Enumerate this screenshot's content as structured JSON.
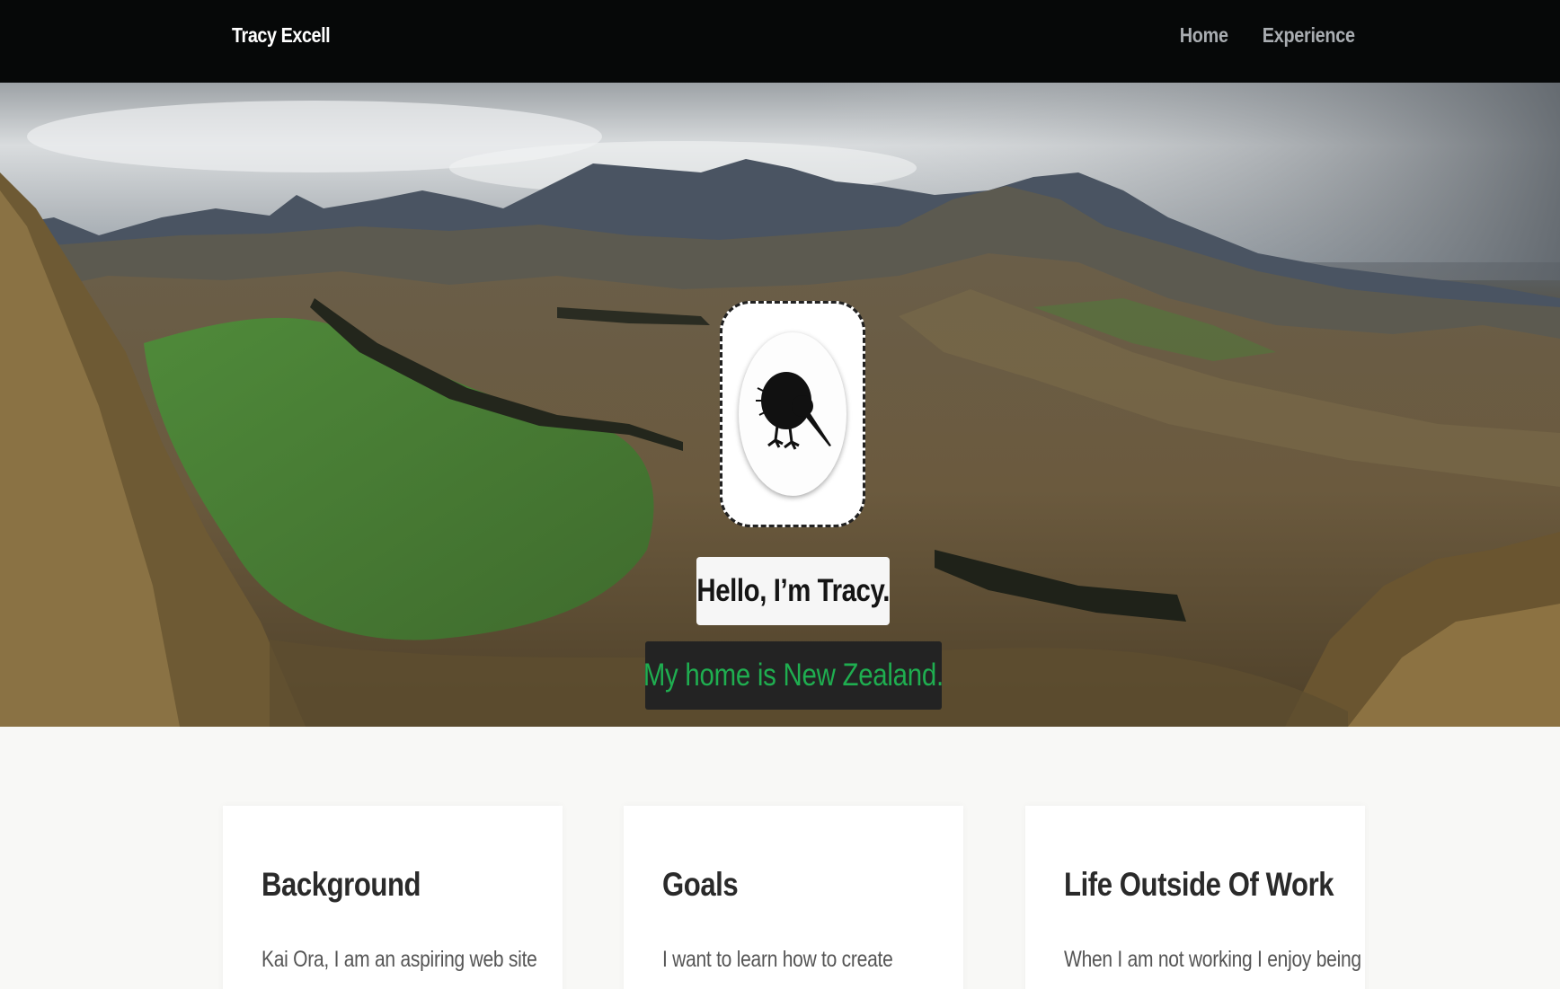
{
  "navbar": {
    "brand": "Tracy Excell",
    "links": [
      {
        "label": "Home"
      },
      {
        "label": "Experience"
      }
    ]
  },
  "hero": {
    "avatar_icon": "kiwi-bird-icon",
    "greeting": "Hello, I’m Tracy.",
    "subtitle": "My home is New Zealand.",
    "subtitle_color": "#1fae50"
  },
  "cards": [
    {
      "title": "Background",
      "text": "Kai Ora, I am an aspiring web site"
    },
    {
      "title": "Goals",
      "text": "I want to learn how to create"
    },
    {
      "title": "Life Outside Of Work",
      "text": "When I am not working I enjoy being"
    }
  ]
}
